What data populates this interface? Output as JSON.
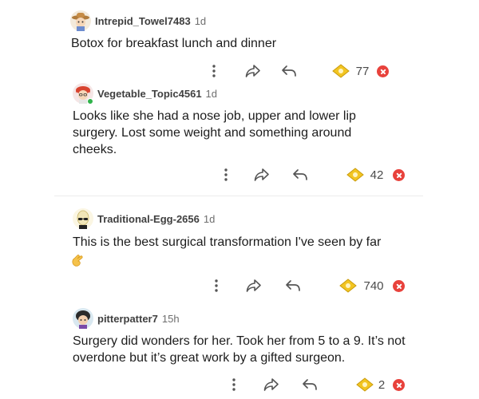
{
  "comments": [
    {
      "username": "Intrepid_Towel7483",
      "age": "1d",
      "text": "Botox for breakfast lunch and dinner",
      "votes": "77",
      "avatar": "cartoon-avatar-cowboy-hat"
    },
    {
      "username": "Vegetable_Topic4561",
      "age": "1d",
      "text": "Looks like she had a nose job, upper and lower lip surgery. Lost some weight and something around cheeks.",
      "votes": "42",
      "avatar": "cartoon-avatar-red-hair",
      "online": true
    },
    {
      "username": "Traditional-Egg-2656",
      "age": "1d",
      "text": "This is the best surgical transformation I've seen by far",
      "emoji": "pinching-hand-emoji",
      "votes": "740",
      "avatar": "cartoon-avatar-egg-head"
    },
    {
      "username": "pitterpatter7",
      "age": "15h",
      "text": "Surgery did wonders for her. Took her from 5 to a 9. It’s not overdone but it’s great work by a gifted surgeon.",
      "votes": "2",
      "avatar": "cartoon-avatar-dark-hair"
    }
  ],
  "icons": {
    "more": "vertical-dots-icon",
    "share": "share-arrow-icon",
    "reply": "reply-arrow-icon",
    "award": "golden-award-icon",
    "close": "red-close-icon"
  },
  "colors": {
    "award": "#f2c522",
    "close": "#e8423c",
    "online": "#2fb34a"
  }
}
